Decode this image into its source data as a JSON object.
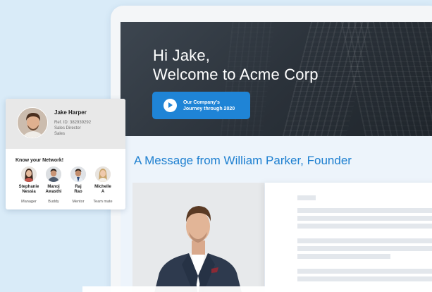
{
  "hero": {
    "greeting": "Hi Jake,",
    "welcome": "Welcome to Acme Corp",
    "video_button": {
      "line1": "Our Company's",
      "line2": "Journey through 2020",
      "icon": "play-icon"
    }
  },
  "message": {
    "title": "A Message from William Parker, Founder"
  },
  "profile": {
    "name": "Jake Harper",
    "ref_id": "Ref. ID: 382939292",
    "role": "Sales Director",
    "department": "Sales"
  },
  "network": {
    "title": "Know your Network!",
    "members": [
      {
        "name_line1": "Stephanie",
        "name_line2": "Nessia",
        "relation": "Manager"
      },
      {
        "name_line1": "Manoj",
        "name_line2": "Awasthi",
        "relation": "Buddy"
      },
      {
        "name_line1": "Raj",
        "name_line2": "Rao",
        "relation": "Mentor"
      },
      {
        "name_line1": "Michelle",
        "name_line2": "A",
        "relation": "Team mate"
      }
    ]
  },
  "colors": {
    "accent": "#1f84d6",
    "title_blue": "#1d7fd0",
    "background": "#d9ebf8"
  }
}
